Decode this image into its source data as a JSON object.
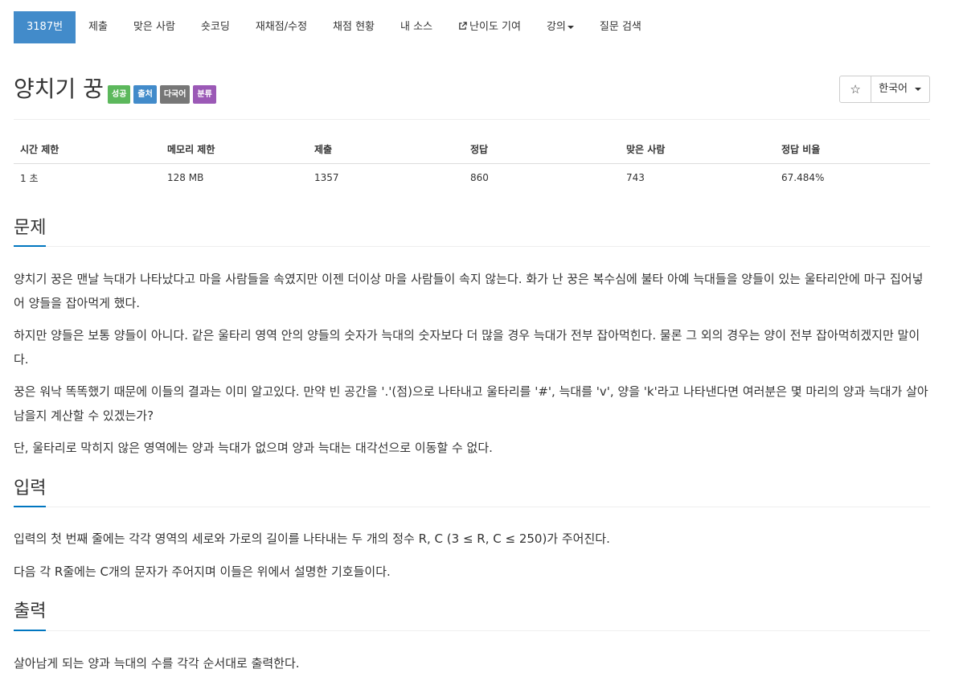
{
  "nav": {
    "problem_number": "3187번",
    "submit": "제출",
    "solved_users": "맞은 사람",
    "short_coding": "숏코딩",
    "rejudge": "재채점/수정",
    "status": "채점 현황",
    "my_source": "내 소스",
    "difficulty": "난이도 기여",
    "lecture": "강의",
    "question_search": "질문 검색"
  },
  "problem": {
    "title": "양치기 꿍",
    "labels": {
      "success": "성공",
      "source": "출처",
      "multilang": "다국어",
      "category": "분류"
    },
    "colors": {
      "success": "#5cb85c",
      "source": "#428bca",
      "multilang": "#777777",
      "category": "#9b59b6",
      "accent": "#428bca"
    },
    "star_icon": "☆",
    "language": "한국어"
  },
  "info_table": {
    "headers": [
      "시간 제한",
      "메모리 제한",
      "제출",
      "정답",
      "맞은 사람",
      "정답 비율"
    ],
    "values": [
      "1 초",
      "128 MB",
      "1357",
      "860",
      "743",
      "67.484%"
    ]
  },
  "sections": {
    "description": {
      "title": "문제",
      "paragraphs": [
        "양치기 꿍은 맨날 늑대가 나타났다고 마을 사람들을 속였지만 이젠 더이상 마을 사람들이 속지 않는다. 화가 난 꿍은 복수심에 불타 아예 늑대들을 양들이 있는 울타리안에 마구 집어넣어 양들을 잡아먹게 했다.",
        "하지만 양들은 보통 양들이 아니다. 같은 울타리 영역 안의 양들의 숫자가 늑대의 숫자보다 더 많을 경우 늑대가 전부 잡아먹힌다. 물론 그 외의 경우는 양이 전부 잡아먹히겠지만 말이다.",
        "꿍은 워낙 똑똑했기 때문에 이들의 결과는 이미 알고있다. 만약 빈 공간을 '.'(점)으로 나타내고 울타리를 '#', 늑대를 'v', 양을 'k'라고 나타낸다면 여러분은 몇 마리의 양과 늑대가 살아남을지 계산할 수 있겠는가?",
        "단, 울타리로 막히지 않은 영역에는 양과 늑대가 없으며 양과 늑대는 대각선으로 이동할 수 없다."
      ]
    },
    "input": {
      "title": "입력",
      "paragraphs": [
        "입력의 첫 번째 줄에는 각각 영역의 세로와 가로의 길이를 나타내는 두 개의 정수 R, C (3 ≤ R, C ≤ 250)가 주어진다.",
        "다음 각 R줄에는 C개의 문자가 주어지며 이들은 위에서 설명한 기호들이다."
      ]
    },
    "output": {
      "title": "출력",
      "paragraphs": [
        "살아남게 되는 양과 늑대의 수를 각각 순서대로 출력한다."
      ]
    }
  }
}
